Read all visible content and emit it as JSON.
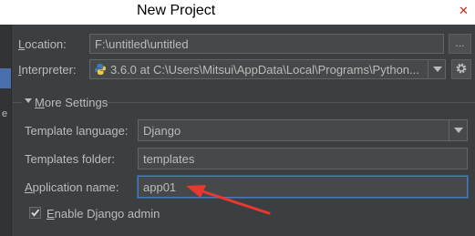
{
  "window": {
    "title": "New Project",
    "close_label": "✕"
  },
  "side": {
    "glyph": "e"
  },
  "location": {
    "label_prefix": "L",
    "label_rest": "ocation:",
    "value": "F:\\untitled\\untitled",
    "browse_label": "..."
  },
  "interpreter": {
    "label_prefix": "I",
    "label_rest": "nterpreter:",
    "value": "3.6.0 at C:\\Users\\Mitsui\\AppData\\Local\\Programs\\Python..."
  },
  "more_settings": {
    "label_prefix": "M",
    "label_rest": "ore Settings"
  },
  "template_language": {
    "label": "Template language:",
    "value": "Django"
  },
  "templates_folder": {
    "label": "Templates folder:",
    "value": "templates"
  },
  "application_name": {
    "label_prefix": "A",
    "label_rest": "pplication name:",
    "value": "app01"
  },
  "enable_admin": {
    "label_prefix": "E",
    "label_rest": "nable Django admin",
    "checked": true
  },
  "colors": {
    "accent": "#4b6eaf",
    "annotation_arrow": "#e8382f",
    "background": "#3c3f41"
  }
}
